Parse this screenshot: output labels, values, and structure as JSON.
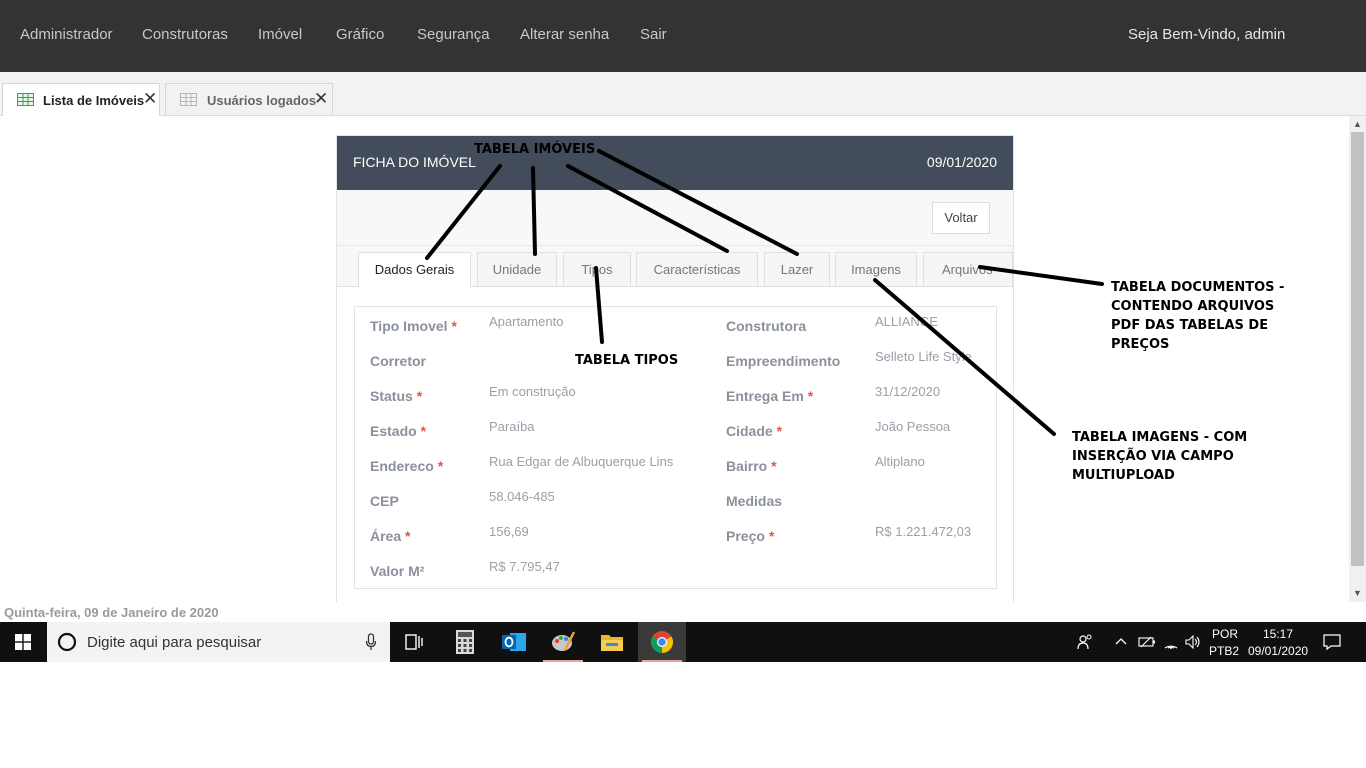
{
  "topnav": {
    "items": [
      "Administrador",
      "Construtoras",
      "Imóvel",
      "Gráfico",
      "Segurança",
      "Alterar senha",
      "Sair"
    ],
    "welcome": "Seja Bem-Vindo, admin"
  },
  "doc_tabs": [
    {
      "label": "Lista de Imóveis",
      "active": true
    },
    {
      "label": "Usuários logados",
      "active": false
    }
  ],
  "card": {
    "title": "FICHA DO IMÓVEL",
    "date": "09/01/2020",
    "back_button": "Voltar",
    "tabs": [
      "Dados Gerais",
      "Unidade",
      "Tipos",
      "Características",
      "Lazer",
      "Imagens",
      "Arquivos"
    ],
    "active_tab": "Dados Gerais",
    "fields_left": [
      {
        "label": "Tipo Imovel",
        "required": true,
        "value": "Apartamento"
      },
      {
        "label": "Corretor",
        "required": false,
        "value": ""
      },
      {
        "label": "Status",
        "required": true,
        "value": "Em construção"
      },
      {
        "label": "Estado",
        "required": true,
        "value": "Paraíba"
      },
      {
        "label": "Endereco",
        "required": true,
        "value": "Rua Edgar de Albuquerque Lins"
      },
      {
        "label": "CEP",
        "required": false,
        "value": "58.046-485"
      },
      {
        "label": "Área",
        "required": true,
        "value": "156,69"
      },
      {
        "label": "Valor M²",
        "required": false,
        "value": "R$ 7.795,47"
      }
    ],
    "fields_right": [
      {
        "label": "Construtora",
        "required": false,
        "value": "ALLIANCE"
      },
      {
        "label": "Empreendimento",
        "required": false,
        "value": "Selleto Life Style"
      },
      {
        "label": "Entrega Em",
        "required": true,
        "value": "31/12/2020"
      },
      {
        "label": "Cidade",
        "required": true,
        "value": "João Pessoa"
      },
      {
        "label": "Bairro",
        "required": true,
        "value": "Altiplano"
      },
      {
        "label": "Medidas",
        "required": false,
        "value": ""
      },
      {
        "label": "Preço",
        "required": true,
        "value": "R$ 1.221.472,03"
      }
    ]
  },
  "status_bar": {
    "date_text": "Quinta-feira, 09 de Janeiro de 2020"
  },
  "annotations": {
    "imoveis": "TABELA IMÓVEIS",
    "tipos": "TABELA TIPOS",
    "documentos": [
      "TABELA DOCUMENTOS -",
      "CONTENDO ARQUIVOS",
      "PDF DAS TABELAS DE",
      "PREÇOS"
    ],
    "imagens": [
      "TABELA IMAGENS - COM",
      "INSERÇÃO VIA CAMPO",
      "MULTIUPLOAD"
    ]
  },
  "taskbar": {
    "search_placeholder": "Digite aqui para pesquisar",
    "apps": [
      "task-view",
      "calculator",
      "outlook",
      "paint",
      "file-explorer",
      "chrome"
    ],
    "lang_top": "POR",
    "lang_bottom": "PTB2",
    "time": "15:17",
    "date": "09/01/2020"
  }
}
